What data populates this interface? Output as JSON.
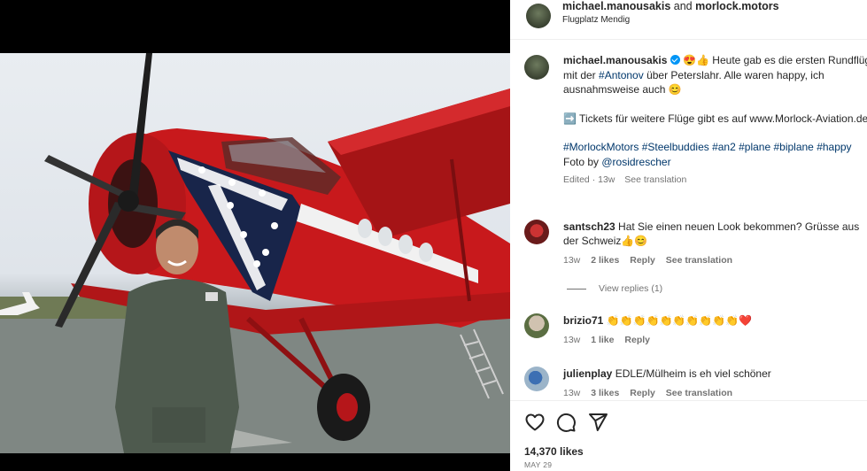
{
  "header": {
    "user1": "michael.manousakis",
    "conjunction": " and ",
    "user2": "morlock.motors",
    "location": "Flugplatz Mendig"
  },
  "caption": {
    "username": "michael.manousakis",
    "emoji_lead": "😍👍",
    "text1": " Heute gab es die ersten Rundflüge mit der ",
    "hashtag_antonov": "#Antonov",
    "text2": " über Peterslahr. Alle waren happy, ich ausnahmsweise auch 😊",
    "tickets": "➡️ Tickets für weitere Flüge gibt es auf www.Morlock-Aviation.de",
    "hashtags": "#MorlockMotors #Steelbuddies #an2 #plane #biplane #happy",
    "foto_by": "Foto by ",
    "photographer": "@rosidrescher",
    "edited": "Edited · 13w",
    "see_translation": "See translation"
  },
  "comments": [
    {
      "username": "santsch23",
      "text": " Hat Sie einen neuen Look bekommen? Grüsse aus der Schweiz👍😊",
      "time": "13w",
      "likes": "2 likes",
      "reply": "Reply",
      "translation": "See translation"
    },
    {
      "username": "brizio71",
      "text": " 👏👏👏👏👏👏👏👏👏👏❤️",
      "time": "13w",
      "likes": "1 like",
      "reply": "Reply"
    },
    {
      "username": "julienplay",
      "text": " EDLE/Mülheim is eh viel schöner",
      "time": "13w",
      "likes": "3 likes",
      "reply": "Reply",
      "translation": "See translation"
    }
  ],
  "view_replies": "View replies (1)",
  "likes_count": "14,370 likes",
  "post_date": "MAY 29",
  "icons": {
    "like": "heart-icon",
    "comment": "comment-icon",
    "share": "share-icon"
  },
  "colors": {
    "link": "#00376b",
    "verified": "#0095f6",
    "plane_red": "#c8191c",
    "heart": "#ed4956"
  }
}
